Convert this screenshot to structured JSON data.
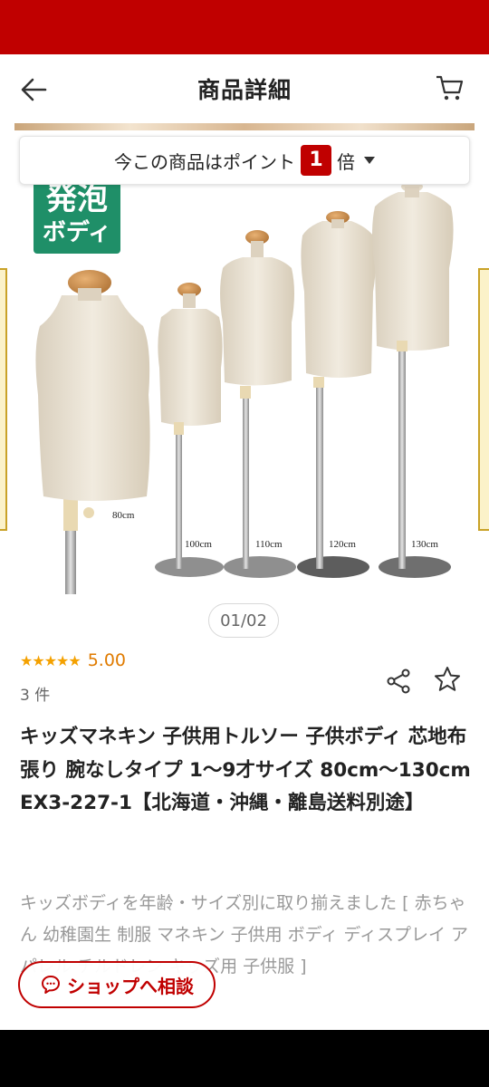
{
  "header": {
    "title": "商品詳細"
  },
  "points_banner": {
    "prefix": "今この商品はポイント",
    "multiplier": "1",
    "suffix": "倍"
  },
  "badge": {
    "line1": "発泡",
    "line2": "ボディ"
  },
  "mannequins": [
    {
      "label": "80cm"
    },
    {
      "label": "100cm"
    },
    {
      "label": "110cm"
    },
    {
      "label": "120cm"
    },
    {
      "label": "130cm"
    }
  ],
  "pager": {
    "text": "01/02"
  },
  "rating": {
    "stars": "★★★★★",
    "score": "5.00",
    "review_count": "3 件"
  },
  "product": {
    "title": "キッズマネキン 子供用トルソー 子供ボディ 芯地布張り 腕なしタイプ 1〜9才サイズ 80cm〜130cm EX3-227-1【北海道・沖縄・離島送料別途】",
    "description": "キッズボディを年齢・サイズ別に取り揃えました [ 赤ちゃん 幼稚園生 制服 マネキン 子供用 ボディ ディスプレイ アパレル チルドレン キッズ用 子供服 ]"
  },
  "chat_button": {
    "label": "ショップへ相談"
  },
  "colors": {
    "brand_red": "#c00000",
    "badge_green": "#1f8f68",
    "star": "#f4a100"
  }
}
